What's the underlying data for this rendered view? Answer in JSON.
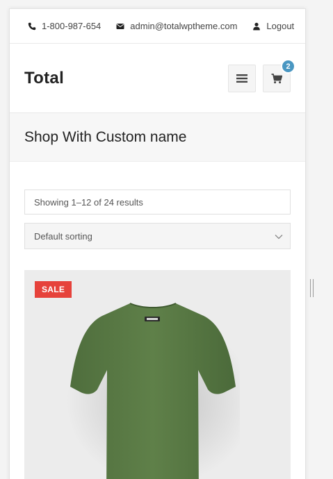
{
  "topbar": {
    "phone": {
      "icon": "phone-icon",
      "text": "1-800-987-654"
    },
    "email": {
      "icon": "envelope-icon",
      "text": "admin@totalwptheme.com"
    },
    "logout": {
      "icon": "user-icon",
      "text": "Logout"
    }
  },
  "header": {
    "logo": "Total",
    "menu_icon": "hamburger-icon",
    "cart_icon": "cart-icon",
    "cart_count": "2"
  },
  "page": {
    "title": "Shop With Custom name"
  },
  "shop": {
    "result_count": "Showing 1–12 of 24 results",
    "sorting": {
      "selected": "Default sorting",
      "icon": "chevron-down-icon"
    }
  },
  "product": {
    "badge": "SALE",
    "image": "green-tshirt-back",
    "shirt_color": "#5a7a46"
  },
  "colors": {
    "sale": "#e6423b",
    "badge": "#4a97c2",
    "title_bg": "#f7f7f7"
  }
}
